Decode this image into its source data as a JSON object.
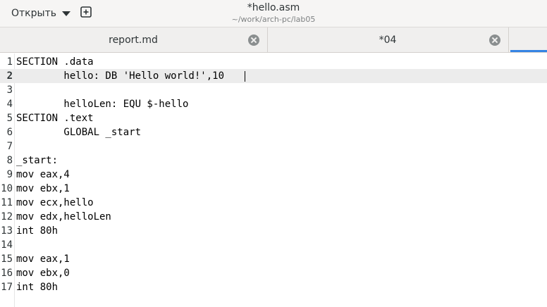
{
  "header": {
    "open_label": "Открыть",
    "title": "*hello.asm",
    "subtitle": "~/work/arch-pc/lab05"
  },
  "tabs": [
    {
      "label": "report.md"
    },
    {
      "label": "*04"
    }
  ],
  "editor": {
    "current_line": 2,
    "lines": [
      {
        "num": "1",
        "text": "SECTION .data"
      },
      {
        "num": "2",
        "text": "        hello: DB 'Hello world!',10 "
      },
      {
        "num": "3",
        "text": ""
      },
      {
        "num": "4",
        "text": "        helloLen: EQU $-hello"
      },
      {
        "num": "5",
        "text": "SECTION .text"
      },
      {
        "num": "6",
        "text": "        GLOBAL _start"
      },
      {
        "num": "7",
        "text": ""
      },
      {
        "num": "8",
        "text": "_start:"
      },
      {
        "num": "9",
        "text": "mov eax,4"
      },
      {
        "num": "10",
        "text": "mov ebx,1"
      },
      {
        "num": "11",
        "text": "mov ecx,hello"
      },
      {
        "num": "12",
        "text": "mov edx,helloLen"
      },
      {
        "num": "13",
        "text": "int 80h"
      },
      {
        "num": "14",
        "text": ""
      },
      {
        "num": "15",
        "text": "mov eax,1"
      },
      {
        "num": "16",
        "text": "mov ebx,0"
      },
      {
        "num": "17",
        "text": "int 80h"
      }
    ]
  },
  "icons": {
    "open_menu": "chevron-down-icon",
    "new_tab": "new-tab-icon",
    "tab_close": "close-icon"
  },
  "colors": {
    "accent": "#3584e4",
    "current_line": "#ececec",
    "headerbar": "#f6f5f4"
  }
}
